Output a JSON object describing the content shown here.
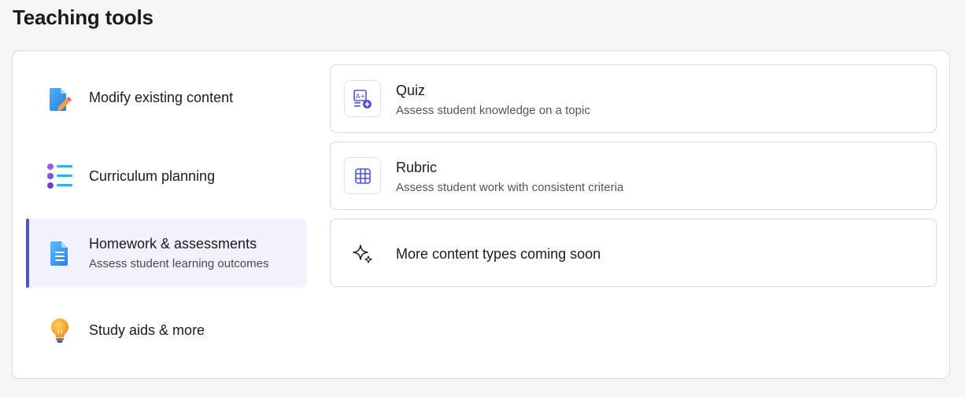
{
  "page": {
    "title": "Teaching tools"
  },
  "categories": [
    {
      "title": "Modify existing content",
      "subtitle": "",
      "icon": "document-pencil-icon",
      "active": false
    },
    {
      "title": "Curriculum planning",
      "subtitle": "",
      "icon": "list-bullets-icon",
      "active": false
    },
    {
      "title": "Homework & assessments",
      "subtitle": "Assess student learning outcomes",
      "icon": "document-lines-icon",
      "active": true
    },
    {
      "title": "Study aids & more",
      "subtitle": "",
      "icon": "lightbulb-icon",
      "active": false
    }
  ],
  "tools": [
    {
      "title": "Quiz",
      "subtitle": "Assess student knowledge on a topic",
      "icon": "quiz-icon"
    },
    {
      "title": "Rubric",
      "subtitle": "Assess student work with consistent criteria",
      "icon": "grid-table-icon"
    },
    {
      "title": "More content types coming soon",
      "subtitle": "",
      "icon": "sparkle-icon"
    }
  ],
  "colors": {
    "accent": "#4f52d9",
    "active_bg": "#f2f1fd",
    "border": "#d9d9d9"
  }
}
